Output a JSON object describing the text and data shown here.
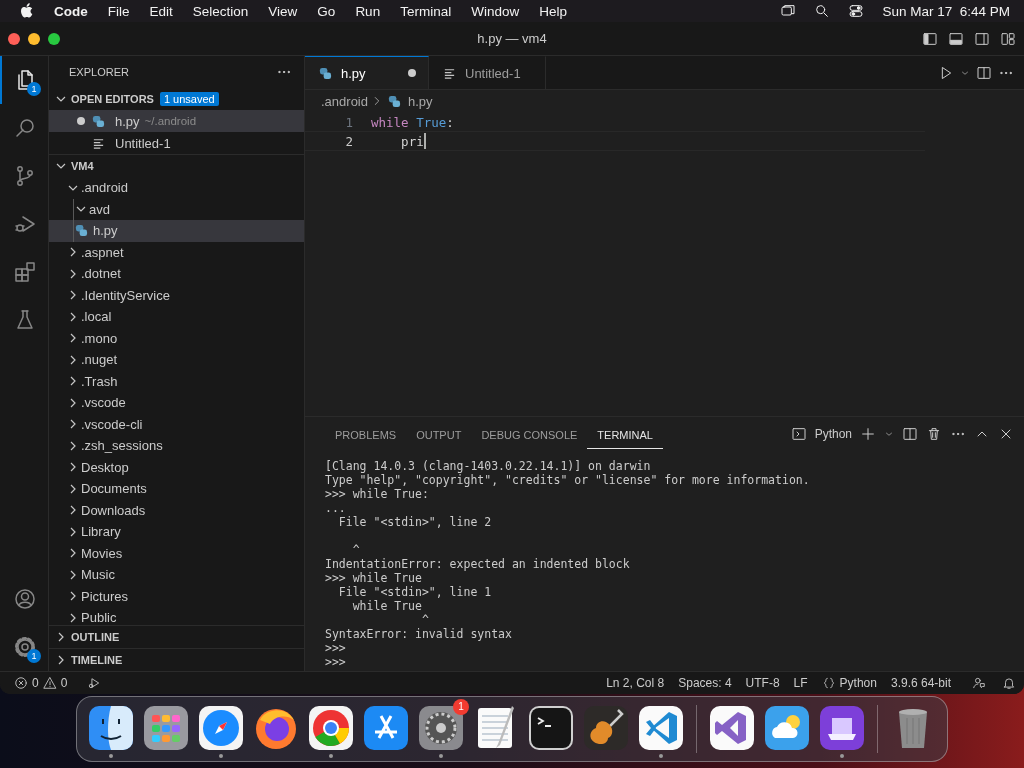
{
  "menubar": {
    "app": "Code",
    "items": [
      "File",
      "Edit",
      "Selection",
      "View",
      "Go",
      "Run",
      "Terminal",
      "Window",
      "Help"
    ],
    "clock": "Sun Mar 17  6:44 PM"
  },
  "window": {
    "title": "h.py — vm4"
  },
  "activity_bar": {
    "items": [
      {
        "kind": "files",
        "selected": true,
        "badge": "1"
      },
      {
        "kind": "search",
        "selected": false
      },
      {
        "kind": "source-control",
        "selected": false
      },
      {
        "kind": "run-debug",
        "selected": false
      },
      {
        "kind": "extensions",
        "selected": false
      },
      {
        "kind": "testing",
        "selected": false
      }
    ],
    "bottom": [
      {
        "kind": "account"
      },
      {
        "kind": "settings",
        "badge": "1"
      }
    ]
  },
  "sidebar": {
    "title": "EXPLORER",
    "open_editors": {
      "label": "OPEN EDITORS",
      "badge": "1 unsaved",
      "expanded": true,
      "items": [
        {
          "name": "h.py",
          "path": "~/.android",
          "kind": "python",
          "dirty": true,
          "selected": true
        },
        {
          "name": "Untitled-1",
          "kind": "text",
          "dirty": false,
          "selected": false
        }
      ]
    },
    "folder": {
      "label": "VM4",
      "expanded": true,
      "children": [
        {
          "name": ".android",
          "kind": "folder",
          "expanded": true,
          "selected": false,
          "children": [
            {
              "name": "avd",
              "kind": "folder",
              "expanded": true,
              "selected": false
            },
            {
              "name": "h.py",
              "kind": "python",
              "selected": true
            }
          ]
        },
        {
          "name": ".aspnet",
          "kind": "folder",
          "expanded": false,
          "selected": false
        },
        {
          "name": ".dotnet",
          "kind": "folder",
          "expanded": false,
          "selected": false
        },
        {
          "name": ".IdentityService",
          "kind": "folder",
          "expanded": false,
          "selected": false
        },
        {
          "name": ".local",
          "kind": "folder",
          "expanded": false,
          "selected": false
        },
        {
          "name": ".mono",
          "kind": "folder",
          "expanded": false,
          "selected": false
        },
        {
          "name": ".nuget",
          "kind": "folder",
          "expanded": false,
          "selected": false
        },
        {
          "name": ".Trash",
          "kind": "folder",
          "expanded": false,
          "selected": false
        },
        {
          "name": ".vscode",
          "kind": "folder",
          "expanded": false,
          "selected": false
        },
        {
          "name": ".vscode-cli",
          "kind": "folder",
          "expanded": false,
          "selected": false
        },
        {
          "name": ".zsh_sessions",
          "kind": "folder",
          "expanded": false,
          "selected": false
        },
        {
          "name": "Desktop",
          "kind": "folder",
          "expanded": false,
          "selected": false
        },
        {
          "name": "Documents",
          "kind": "folder",
          "expanded": false,
          "selected": false
        },
        {
          "name": "Downloads",
          "kind": "folder",
          "expanded": false,
          "selected": false
        },
        {
          "name": "Library",
          "kind": "folder",
          "expanded": false,
          "selected": false
        },
        {
          "name": "Movies",
          "kind": "folder",
          "expanded": false,
          "selected": false
        },
        {
          "name": "Music",
          "kind": "folder",
          "expanded": false,
          "selected": false
        },
        {
          "name": "Pictures",
          "kind": "folder",
          "expanded": false,
          "selected": false
        },
        {
          "name": "Public",
          "kind": "folder",
          "expanded": false,
          "selected": false
        }
      ]
    },
    "sections": [
      {
        "label": "OUTLINE",
        "expanded": false
      },
      {
        "label": "TIMELINE",
        "expanded": false
      }
    ]
  },
  "editor": {
    "tabs": [
      {
        "name": "h.py",
        "kind": "python",
        "dirty": true,
        "selected": true
      },
      {
        "name": "Untitled-1",
        "kind": "text",
        "dirty": false,
        "selected": false
      }
    ],
    "breadcrumbs": [
      {
        "text": ".android",
        "kind": "folder"
      },
      {
        "text": "h.py",
        "kind": "python"
      }
    ],
    "lines": [
      {
        "number": "1",
        "current": false,
        "tokens": [
          {
            "text": "while",
            "kind": "keyword"
          },
          {
            "text": " True",
            "kind": "constant"
          },
          {
            "text": ":",
            "kind": "plain"
          }
        ]
      },
      {
        "number": "2",
        "current": true,
        "tokens": [
          {
            "text": "    pri",
            "kind": "plain"
          }
        ]
      }
    ]
  },
  "panel": {
    "tabs": [
      {
        "label": "PROBLEMS",
        "selected": false
      },
      {
        "label": "OUTPUT",
        "selected": false
      },
      {
        "label": "DEBUG CONSOLE",
        "selected": false
      },
      {
        "label": "TERMINAL",
        "selected": true
      }
    ],
    "terminal_name": "Python",
    "output": "[Clang 14.0.3 (clang-1403.0.22.14.1)] on darwin\nType \"help\", \"copyright\", \"credits\" or \"license\" for more information.\n>>> while True:\n...\n  File \"<stdin>\", line 2\n\n    ^\nIndentationError: expected an indented block\n>>> while True\n  File \"<stdin>\", line 1\n    while True\n              ^\nSyntaxError: invalid syntax\n>>>\n>>>"
  },
  "status_bar": {
    "errors": "0",
    "warnings": "0",
    "items": [
      {
        "text": "Ln 2, Col 8",
        "kind": "text"
      },
      {
        "text": "Spaces: 4",
        "kind": "text"
      },
      {
        "text": "UTF-8",
        "kind": "text"
      },
      {
        "text": "LF",
        "kind": "text"
      },
      {
        "text": "Python",
        "kind": "language"
      },
      {
        "text": "3.9.6 64-bit",
        "kind": "text"
      }
    ]
  },
  "dock": {
    "items": [
      {
        "kind": "finder",
        "running": true
      },
      {
        "kind": "launchpad",
        "running": false
      },
      {
        "kind": "safari",
        "running": true
      },
      {
        "kind": "firefox",
        "running": false
      },
      {
        "kind": "chrome",
        "running": true
      },
      {
        "kind": "appstore",
        "running": false
      },
      {
        "kind": "settings",
        "running": true,
        "badge": "1"
      },
      {
        "kind": "textedit",
        "running": false
      },
      {
        "kind": "terminal",
        "running": false
      },
      {
        "kind": "garageband",
        "running": false
      },
      {
        "kind": "vscode",
        "running": true
      },
      {
        "kind": "separator"
      },
      {
        "kind": "visualstudio",
        "running": false
      },
      {
        "kind": "weather",
        "running": false
      },
      {
        "kind": "configurator",
        "running": true
      },
      {
        "kind": "separator"
      },
      {
        "kind": "trash",
        "running": false
      }
    ]
  }
}
